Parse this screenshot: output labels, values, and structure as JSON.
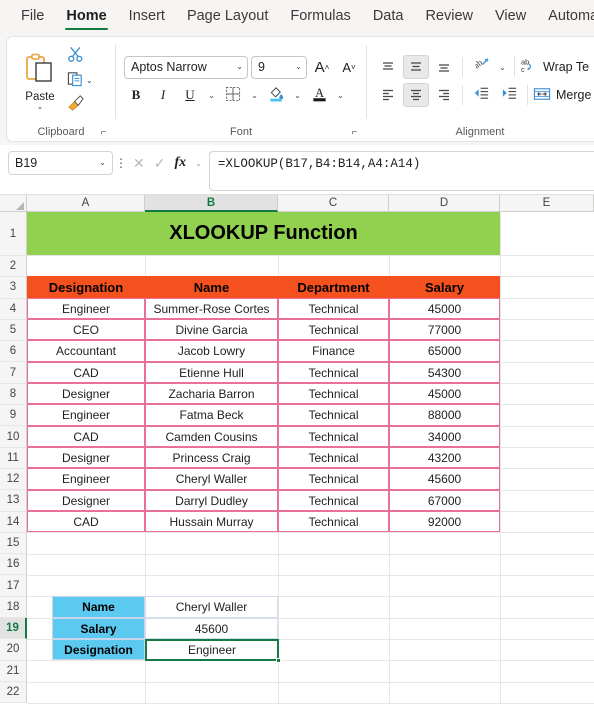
{
  "ribbon": {
    "tabs": [
      {
        "label": "File",
        "active": false
      },
      {
        "label": "Home",
        "active": true
      },
      {
        "label": "Insert",
        "active": false
      },
      {
        "label": "Page Layout",
        "active": false
      },
      {
        "label": "Formulas",
        "active": false
      },
      {
        "label": "Data",
        "active": false
      },
      {
        "label": "Review",
        "active": false
      },
      {
        "label": "View",
        "active": false
      },
      {
        "label": "Automate",
        "active": false
      }
    ],
    "clipboard": {
      "group_label": "Clipboard",
      "paste_label": "Paste",
      "cut_icon": "scissors-icon",
      "copy_icon": "copy-icon",
      "format_painter_icon": "paintbrush-icon"
    },
    "font": {
      "group_label": "Font",
      "font_name": "Aptos Narrow",
      "font_size": "9",
      "grow_font": "A",
      "shrink_font": "A",
      "bold": "B",
      "italic": "I",
      "underline": "U",
      "borders_icon": "borders-icon",
      "fill_color_icon": "fill-color-icon",
      "font_color_icon": "font-color-icon"
    },
    "alignment": {
      "group_label": "Alignment",
      "wrap_text": "Wrap Te",
      "merge_center": "Merge &",
      "orientation_icon": "text-orientation-icon",
      "decrease_indent_icon": "decrease-indent-icon",
      "increase_indent_icon": "increase-indent-icon"
    }
  },
  "formula_bar": {
    "name_box": "B19",
    "formula": "=XLOOKUP(B17,B4:B14,A4:A14)",
    "cancel_icon": "cancel-icon",
    "enter_icon": "check-icon",
    "insert_function_icon": "fx-icon"
  },
  "grid": {
    "columns": [
      "A",
      "B",
      "C",
      "D",
      "E"
    ],
    "selected_column": "B",
    "selected_row": "19",
    "rows": [
      "1",
      "2",
      "3",
      "4",
      "5",
      "6",
      "7",
      "8",
      "9",
      "10",
      "11",
      "12",
      "13",
      "14",
      "15",
      "16",
      "17",
      "18",
      "19",
      "20",
      "21",
      "22"
    ],
    "title": "XLOOKUP Function",
    "table_headers": [
      "Designation",
      "Name",
      "Department",
      "Salary"
    ],
    "table_rows": [
      [
        "Engineer",
        "Summer-Rose Cortes",
        "Technical",
        "45000"
      ],
      [
        "CEO",
        "Divine Garcia",
        "Technical",
        "77000"
      ],
      [
        "Accountant",
        "Jacob Lowry",
        "Finance",
        "65000"
      ],
      [
        "CAD",
        "Etienne Hull",
        "Technical",
        "54300"
      ],
      [
        "Designer",
        "Zacharia Barron",
        "Technical",
        "45000"
      ],
      [
        "Engineer",
        "Fatma Beck",
        "Technical",
        "88000"
      ],
      [
        "CAD",
        "Camden Cousins",
        "Technical",
        "34000"
      ],
      [
        "Designer",
        "Princess Craig",
        "Technical",
        "43200"
      ],
      [
        "Engineer",
        "Cheryl Waller",
        "Technical",
        "45600"
      ],
      [
        "Designer",
        "Darryl Dudley",
        "Technical",
        "67000"
      ],
      [
        "CAD",
        "Hussain Murray",
        "Technical",
        "92000"
      ]
    ],
    "lookup_rows": [
      {
        "label": "Name",
        "value": "Cheryl Waller"
      },
      {
        "label": "Salary",
        "value": "45600"
      },
      {
        "label": "Designation",
        "value": "Engineer"
      }
    ]
  },
  "colors": {
    "title_fill": "#92d050",
    "header_fill": "#f4511e",
    "label_fill": "#5cc9f0",
    "table_border": "#e8709a",
    "accent_green": "#107c41"
  }
}
